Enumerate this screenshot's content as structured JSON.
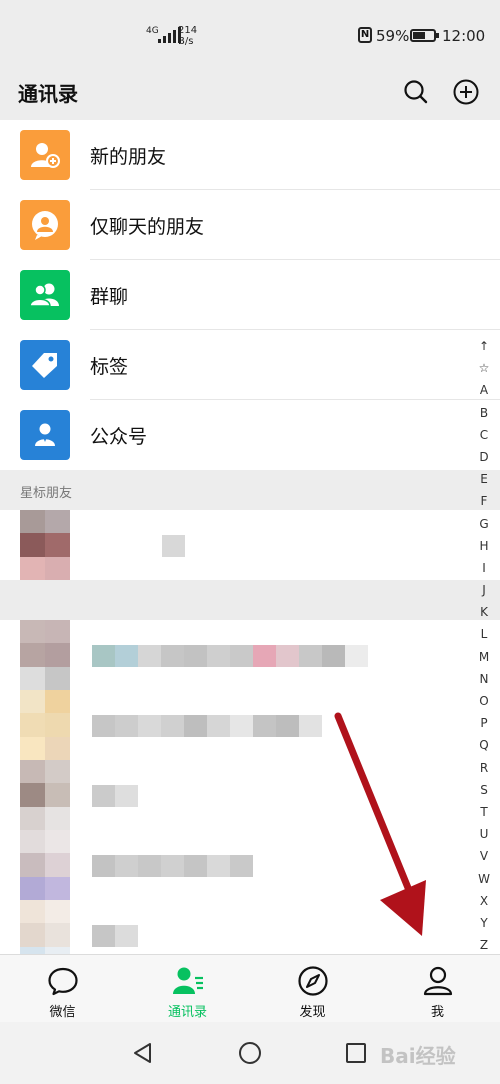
{
  "status_bar": {
    "network": "4G",
    "speed_value": "214",
    "speed_unit": "B/s",
    "battery": "59%",
    "time": "12:00"
  },
  "header": {
    "title": "通讯录"
  },
  "function_items": [
    {
      "label": "新的朋友",
      "icon": "add-friend-icon",
      "color": "#fa9d3b"
    },
    {
      "label": "仅聊天的朋友",
      "icon": "chat-only-icon",
      "color": "#fa9d3b"
    },
    {
      "label": "群聊",
      "icon": "group-icon",
      "color": "#07c160"
    },
    {
      "label": "标签",
      "icon": "tag-icon",
      "color": "#2782d7"
    },
    {
      "label": "公众号",
      "icon": "official-account-icon",
      "color": "#2782d7"
    }
  ],
  "section": {
    "starred_title": "星标朋友"
  },
  "index_letters": [
    "↑",
    "☆",
    "A",
    "B",
    "C",
    "D",
    "E",
    "F",
    "G",
    "H",
    "I",
    "J",
    "K",
    "L",
    "M",
    "N",
    "O",
    "P",
    "Q",
    "R",
    "S",
    "T",
    "U",
    "V",
    "W",
    "X",
    "Y",
    "Z",
    "#"
  ],
  "tabs": [
    {
      "label": "微信",
      "icon": "chat-bubble-icon"
    },
    {
      "label": "通讯录",
      "icon": "contacts-icon",
      "active": true
    },
    {
      "label": "发现",
      "icon": "compass-icon"
    },
    {
      "label": "我",
      "icon": "person-icon"
    }
  ],
  "watermark": "Bai经验",
  "colors": {
    "accent": "#07c160",
    "arrow": "#b0121b"
  }
}
